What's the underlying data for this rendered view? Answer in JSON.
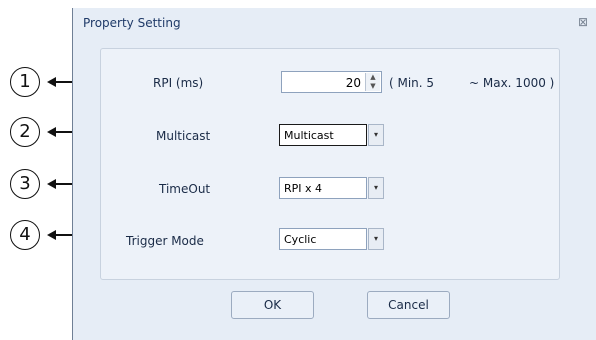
{
  "dialog": {
    "title": "Property Setting",
    "close_glyph": "⊠",
    "rpi": {
      "label": "RPI (ms)",
      "value": "20",
      "min_text": "( Min. 5",
      "max_text": "~ Max. 1000  )"
    },
    "multicast": {
      "label": "Multicast",
      "value": "Multicast"
    },
    "timeout": {
      "label": "TimeOut",
      "value": "RPI x 4"
    },
    "trigger_mode": {
      "label": "Trigger Mode",
      "value": "Cyclic"
    },
    "ok_label": "OK",
    "cancel_label": "Cancel",
    "spin_up": "▲",
    "spin_down": "▼",
    "combo_arrow": "▾"
  },
  "callouts": [
    "1",
    "2",
    "3",
    "4"
  ]
}
